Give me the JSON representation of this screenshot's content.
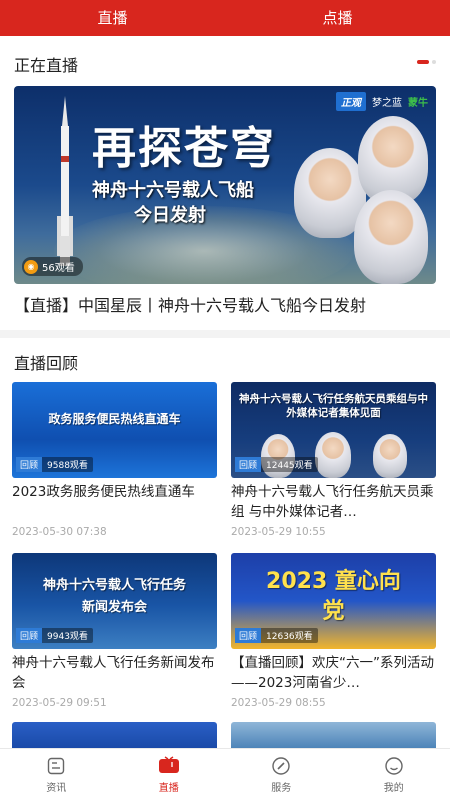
{
  "top_tabs": [
    "直播",
    "点播"
  ],
  "live_section": {
    "title": "正在直播",
    "hero": {
      "big_title": "再探苍穹",
      "subtitle_line1": "神舟十六号载人飞船",
      "subtitle_line2": "今日发射",
      "logos": [
        "正观",
        "梦之蓝",
        "蒙牛"
      ],
      "views": "56观看",
      "caption": "【直播】中国星辰丨神舟十六号载人飞船今日发射"
    }
  },
  "replay_section": {
    "title": "直播回顾",
    "cards": [
      {
        "thumb_title": "政务服务便民热线直通车",
        "tag": "回顾",
        "views": "9588观看",
        "title": "2023政务服务便民热线直通车",
        "date": "2023-05-30 07:38"
      },
      {
        "thumb_title": "神舟十六号载人飞行任务航天员乘组与中外媒体记者集体见面",
        "tag": "回顾",
        "views": "12445观看",
        "title": "神舟十六号载人飞行任务航天员乘组 与中外媒体记者…",
        "date": "2023-05-29 10:55"
      },
      {
        "thumb_title": "神舟十六号载人飞行任务新闻发布会",
        "tag": "回顾",
        "views": "9943观看",
        "title": "神舟十六号载人飞行任务新闻发布会",
        "date": "2023-05-29 09:51"
      },
      {
        "thumb_title": "2023 童心向党",
        "tag": "回顾",
        "views": "12636观看",
        "title": "【直播回顾】欢庆“六一”系列活动——2023河南省少…",
        "date": "2023-05-29 08:55"
      }
    ]
  },
  "bottom_nav": [
    {
      "label": "资讯",
      "icon": "news-icon"
    },
    {
      "label": "直播",
      "icon": "live-tv-icon"
    },
    {
      "label": "服务",
      "icon": "compass-icon"
    },
    {
      "label": "我的",
      "icon": "profile-icon"
    }
  ],
  "colors": {
    "brand": "#d8261e",
    "tag": "#2e7bd6"
  }
}
